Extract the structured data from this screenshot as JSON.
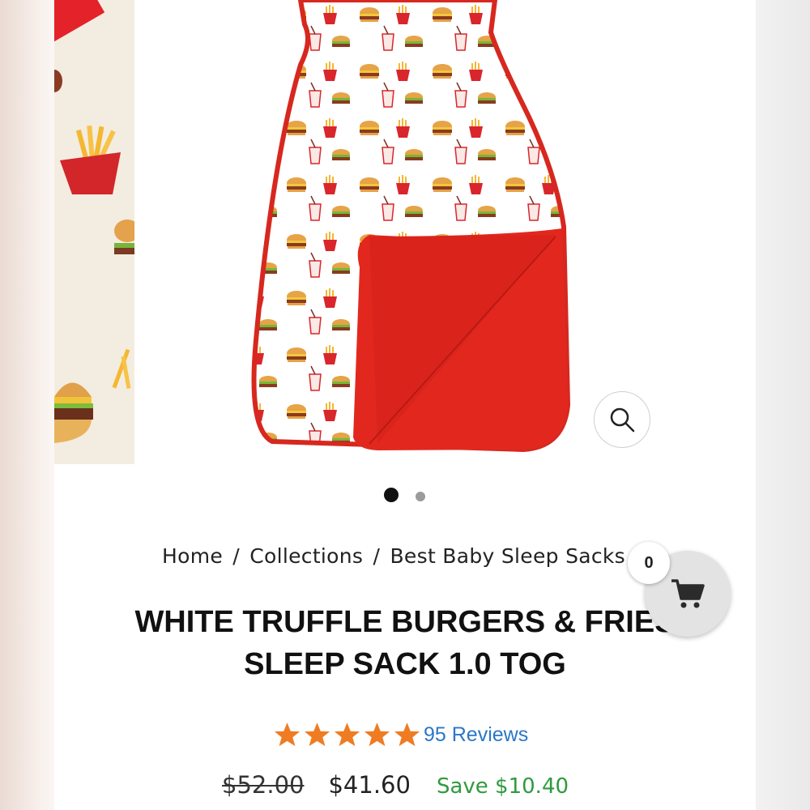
{
  "gallery": {
    "zoom_icon": "search-icon",
    "dots": 2,
    "active_dot": 0
  },
  "breadcrumb": {
    "items": [
      "Home",
      "Collections",
      "Best Baby Sleep Sacks"
    ],
    "separator": "/"
  },
  "product": {
    "title_line1": "WHITE TRUFFLE BURGERS & FRIES",
    "title_line2": "SLEEP SACK 1.0 TOG",
    "rating": 5,
    "reviews": "95 Reviews",
    "old_price": "$52.00",
    "price": "$41.60",
    "save": "Save $10.40"
  },
  "cart": {
    "count": "0",
    "icon": "cart-icon"
  },
  "colors": {
    "accent_red": "#e3222a",
    "star": "#ef7c22",
    "link": "#2c77c6",
    "save": "#2f9a3f"
  }
}
